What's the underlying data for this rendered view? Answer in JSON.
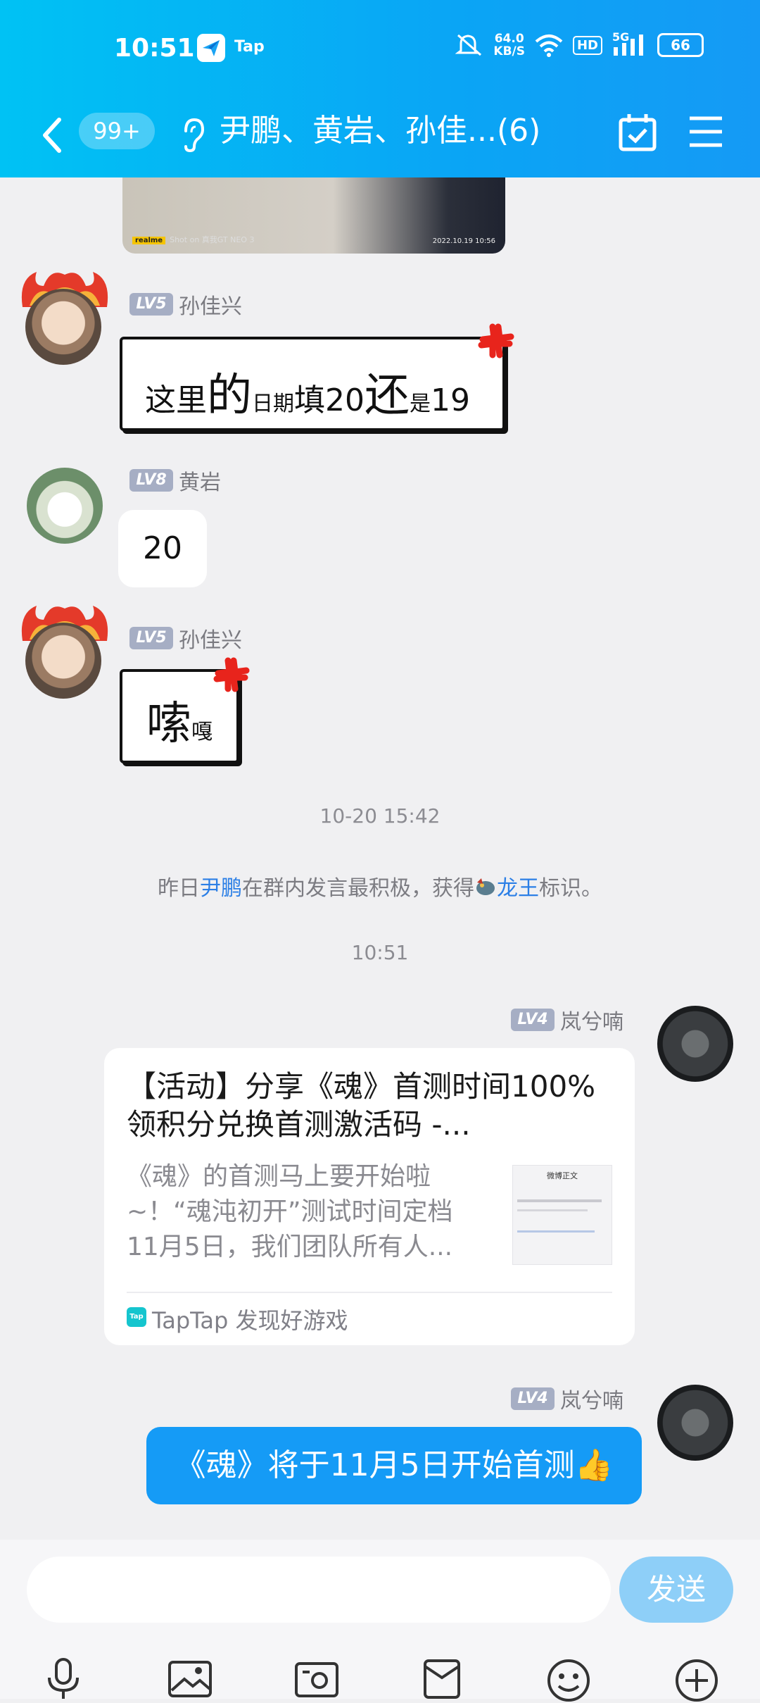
{
  "status_bar": {
    "time": "10:51",
    "app_badge": "Tap",
    "net_speed_value": "64.0",
    "net_speed_unit": "KB/S",
    "hd": "HD",
    "network": "5G",
    "battery": "66"
  },
  "nav": {
    "unread": "99+",
    "title": "尹鹏、黄岩、孙佳...(6)",
    "icons": [
      "back-arrow-icon",
      "earpiece-icon",
      "calendar-check-icon",
      "menu-icon"
    ]
  },
  "photo": {
    "camera_brand": "realme",
    "camera_text": "Shot on 真我GT NEO 3",
    "timestamp": "2022.10.19 10:56"
  },
  "messages": [
    {
      "level": "LV5",
      "sender": "孙佳兴",
      "text_parts": [
        "这里",
        "的",
        "日期",
        "填20",
        "还",
        "是",
        "19"
      ]
    },
    {
      "level": "LV8",
      "sender": "黄岩",
      "text": "20"
    },
    {
      "level": "LV5",
      "sender": "孙佳兴",
      "text_parts": [
        "嗦",
        "嘎"
      ]
    }
  ],
  "time_1": "10-20 15:42",
  "system": {
    "prefix": "昨日",
    "user": "尹鹏",
    "middle": "在群内发言最积极，获得",
    "badge": "龙王",
    "suffix": "标识。"
  },
  "time_2": "10:51",
  "my_messages": [
    {
      "level": "LV4",
      "sender": "岚兮喃"
    },
    {
      "level": "LV4",
      "sender": "岚兮喃",
      "text": "《魂》将于11月5日开始首测👍"
    }
  ],
  "card": {
    "title": "【活动】分享《魂》首测时间100%领积分兑换首测激活码 -...",
    "desc": "《魂》的首测马上要开始啦~！“魂沌初开”测试时间定档11月5日，我们团队所有人...",
    "thumb_title": "微博正文",
    "source_icon": "Tap",
    "source": "TapTap 发现好游戏"
  },
  "input": {
    "placeholder": "",
    "send": "发送"
  },
  "toolbar": [
    "microphone-icon",
    "image-icon",
    "camera-icon",
    "red-packet-icon",
    "emoji-icon",
    "plus-icon"
  ]
}
